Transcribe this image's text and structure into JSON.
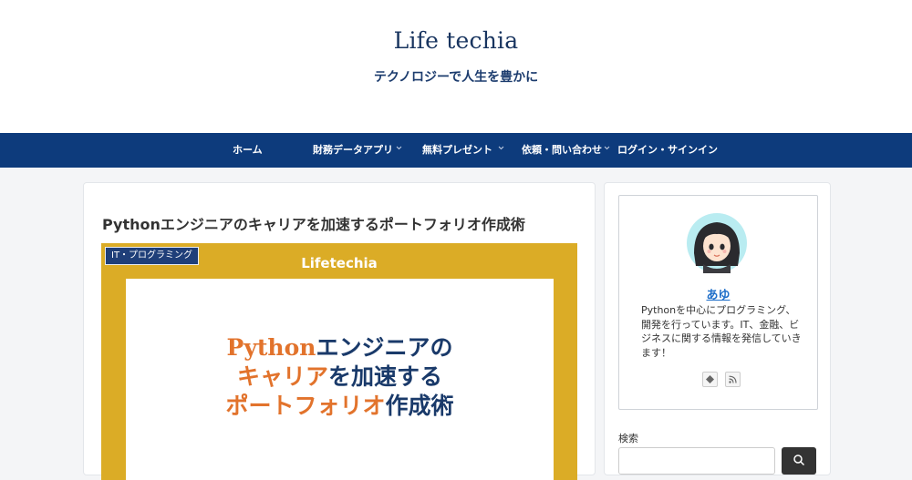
{
  "site": {
    "title": "Life techia",
    "tagline": "テクノロジーで人生を豊かに"
  },
  "nav": {
    "items": [
      {
        "label": "ホーム",
        "has_submenu": false
      },
      {
        "label": "財務データアプリ",
        "has_submenu": true
      },
      {
        "label": "無料プレゼント",
        "has_submenu": true
      },
      {
        "label": "依頼・問い合わせ",
        "has_submenu": true
      },
      {
        "label": "ログイン・サインイン",
        "has_submenu": false
      }
    ]
  },
  "article": {
    "title": "Pythonエンジニアのキャリアを加速するポートフォリオ作成術",
    "category": "IT・プログラミング",
    "eyecatch": {
      "brand": "Lifetechia",
      "line1_part1": "Python",
      "line1_part2": "エンジニアの",
      "line2_part1": "キャリア",
      "line2_part2": "を加速する",
      "line3_part1": "ポートフォリオ",
      "line3_part2": "作成術"
    }
  },
  "sidebar": {
    "profile": {
      "name": "あゆ",
      "bio": "Pythonを中心にプログラミング、開発を行っています。IT、金融、ビジネスに関する情報を発信していきます！"
    },
    "social_icons": [
      "feedly-icon",
      "rss-icon"
    ],
    "search": {
      "label": "検索",
      "placeholder": ""
    }
  },
  "colors": {
    "nav_bg": "#0d3b7c",
    "eyecatch_bg": "#dbac26",
    "accent_orange": "#e2732c",
    "link_blue": "#1f6fc9"
  }
}
